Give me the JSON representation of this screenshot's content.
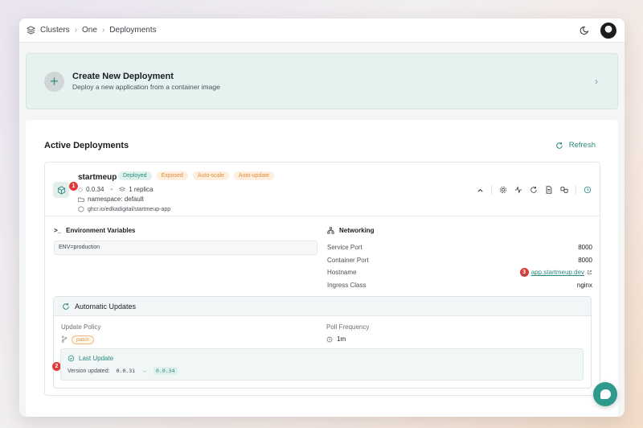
{
  "breadcrumb": {
    "items": [
      "Clusters",
      "One",
      "Deployments"
    ]
  },
  "create": {
    "title": "Create New Deployment",
    "subtitle": "Deploy a new application from a container image"
  },
  "deployments": {
    "title": "Active Deployments",
    "refresh_label": "Refresh",
    "item": {
      "name": "startmeup",
      "badges": [
        "Deployed",
        "Exposed",
        "Auto-scale",
        "Auto-update"
      ],
      "version": "0.0.34",
      "replicas": "1 replica",
      "namespace": "namespace: default",
      "image": "ghcr.io/edkadigital/startmeup-app",
      "env": {
        "title": "Environment Variables",
        "value": "ENV=production"
      },
      "networking": {
        "title": "Networking",
        "rows": [
          {
            "label": "Service Port",
            "value": "8000"
          },
          {
            "label": "Container Port",
            "value": "8000"
          },
          {
            "label": "Hostname",
            "value": "app.startmeup.dev"
          },
          {
            "label": "Ingress Class",
            "value": "nginx"
          }
        ]
      },
      "auto_updates": {
        "title": "Automatic Updates",
        "policy_label": "Update Policy",
        "policy_value": "patch",
        "freq_label": "Poll Frequency",
        "freq_value": "1m",
        "last_update": {
          "title": "Last Update",
          "label": "Version updated:",
          "from": "0.0.31",
          "to": "0.0.34"
        }
      }
    }
  },
  "markers": [
    "1",
    "2",
    "3"
  ],
  "colors": {
    "accent": "#2b8a7e",
    "badge_orange": "#e0903b",
    "marker": "#e03b3b"
  }
}
